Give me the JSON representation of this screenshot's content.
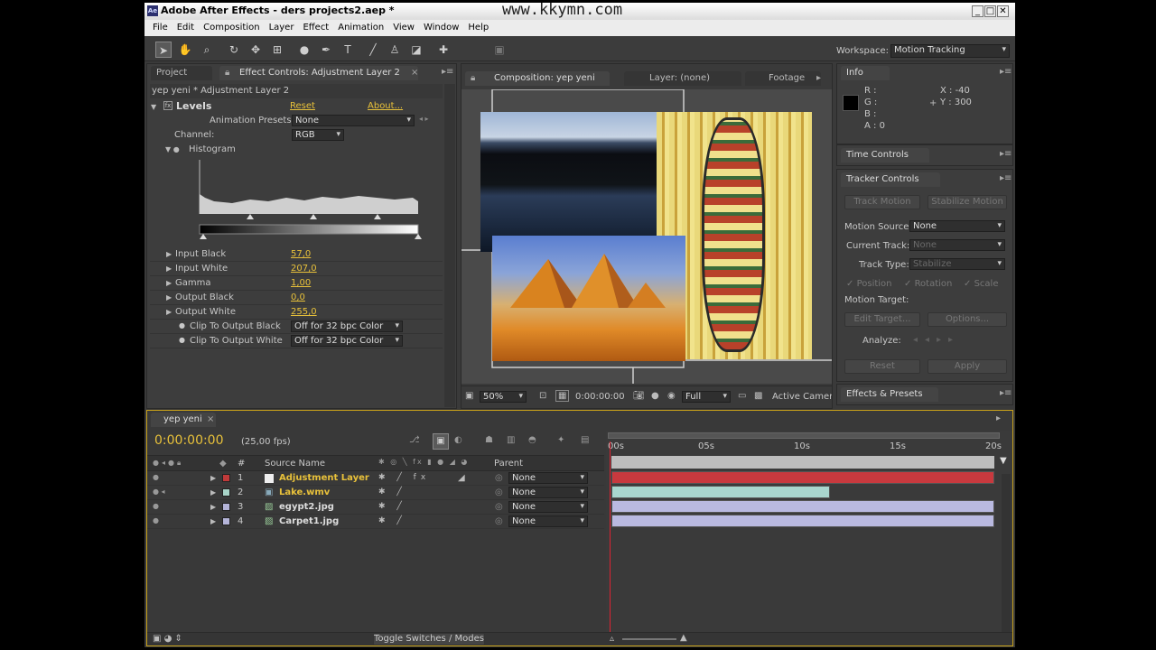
{
  "window": {
    "title": "Adobe After Effects - ders projects2.aep *",
    "watermark": "www.kkymn.com",
    "icon": "ae-logo-icon"
  },
  "menu": [
    "File",
    "Edit",
    "Composition",
    "Layer",
    "Effect",
    "Animation",
    "View",
    "Window",
    "Help"
  ],
  "workspace": {
    "label": "Workspace:",
    "value": "Motion Tracking"
  },
  "project_tab": "Project",
  "effect_tab": "Effect Controls: Adjustment Layer 2",
  "effect_subtitle": "yep yeni * Adjustment Layer 2",
  "levels": {
    "name": "Levels",
    "reset": "Reset",
    "about": "About...",
    "presets_label": "Animation Presets:",
    "presets_value": "None",
    "channel_label": "Channel:",
    "channel_value": "RGB",
    "histogram_label": "Histogram",
    "params": [
      {
        "label": "Input Black",
        "value": "57,0"
      },
      {
        "label": "Input White",
        "value": "207,0"
      },
      {
        "label": "Gamma",
        "value": "1,00"
      },
      {
        "label": "Output Black",
        "value": "0,0"
      },
      {
        "label": "Output White",
        "value": "255,0"
      }
    ],
    "clip_black_label": "Clip To Output Black",
    "clip_black_value": "Off for 32 bpc Color",
    "clip_white_label": "Clip To Output White",
    "clip_white_value": "Off for 32 bpc Color"
  },
  "comp_tabs": {
    "comp": "Composition: yep yeni",
    "layer": "Layer: (none)",
    "footage": "Footage"
  },
  "comp_footer": {
    "zoom": "50%",
    "time": "0:00:00:00",
    "resolution": "Full",
    "camera": "Active Camera"
  },
  "info": {
    "tab": "Info",
    "r": "R :",
    "g": "G :",
    "b": "B :",
    "a": "A : 0",
    "x": "X : -40",
    "y": "Y : 300"
  },
  "time_controls_tab": "Time Controls",
  "tracker": {
    "tab": "Tracker Controls",
    "track_motion": "Track Motion",
    "stabilize_motion": "Stabilize Motion",
    "motion_source_label": "Motion Source:",
    "motion_source": "None",
    "current_track_label": "Current Track:",
    "current_track": "None",
    "track_type_label": "Track Type:",
    "track_type": "Stabilize",
    "position": "Position",
    "rotation": "Rotation",
    "scale": "Scale",
    "motion_target_label": "Motion Target:",
    "edit_target": "Edit Target...",
    "options": "Options...",
    "analyze_label": "Analyze:",
    "reset": "Reset",
    "apply": "Apply"
  },
  "effects_presets_tab": "Effects & Presets",
  "timeline": {
    "tab": "yep yeni",
    "timecode": "0:00:00:00",
    "fps": "(25,00 fps)",
    "col_number": "#",
    "col_source": "Source Name",
    "col_parent": "Parent",
    "ruler": [
      "00s",
      "05s",
      "10s",
      "15s",
      "20s"
    ],
    "layers": [
      {
        "num": "1",
        "name": "Adjustment Layer",
        "parent": "None",
        "color": "#c03a3a",
        "bar_color": "#c8393e",
        "bar_start": 0.0,
        "bar_end": 1.0
      },
      {
        "num": "2",
        "name": "Lake.wmv",
        "parent": "None",
        "color": "#a8d4c8",
        "bar_color": "#a9d6ce",
        "bar_start": 0.0,
        "bar_end": 0.57
      },
      {
        "num": "3",
        "name": "egypt2.jpg",
        "parent": "None",
        "color": "#b4b4d8",
        "bar_color": "#b9b9e0",
        "bar_start": 0.0,
        "bar_end": 1.0
      },
      {
        "num": "4",
        "name": "Carpet1.jpg",
        "parent": "None",
        "color": "#b4b4d8",
        "bar_color": "#b9b9e0",
        "bar_start": 0.0,
        "bar_end": 1.0
      }
    ],
    "toggle": "Toggle Switches / Modes"
  }
}
